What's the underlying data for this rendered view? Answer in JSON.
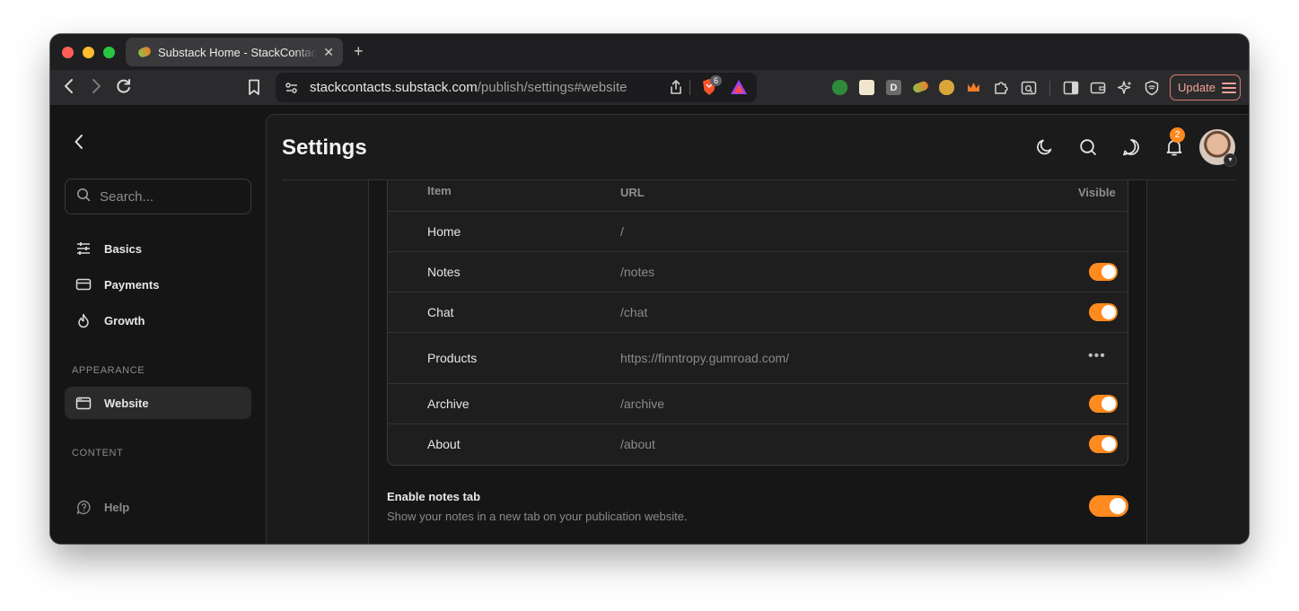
{
  "browser": {
    "tab_title": "Substack Home - StackContacts",
    "url_host": "stackcontacts.substack.com",
    "url_path": "/publish/settings#website",
    "brave_badge": "6",
    "extensions": [
      "ext-green-icon",
      "ext-crown-badge-icon",
      "ext-d-icon",
      "ext-leaf-icon",
      "ext-monkey-icon",
      "ext-crown-icon",
      "puzzle-icon",
      "ext-search-icon"
    ],
    "update_label": "Update"
  },
  "sidebar": {
    "search_placeholder": "Search...",
    "items": [
      {
        "label": "Basics",
        "icon": "sliders-icon"
      },
      {
        "label": "Payments",
        "icon": "card-icon"
      },
      {
        "label": "Growth",
        "icon": "flame-icon"
      }
    ],
    "sections": {
      "appearance": "APPEARANCE",
      "content": "CONTENT"
    },
    "website_label": "Website",
    "help_label": "Help"
  },
  "header": {
    "title": "Settings",
    "notification_count": "2"
  },
  "nav_table": {
    "headers": {
      "item": "Item",
      "url": "URL",
      "visible": "Visible"
    },
    "rows": [
      {
        "item": "Home",
        "url": "/",
        "control": "none"
      },
      {
        "item": "Notes",
        "url": "/notes",
        "control": "toggle",
        "on": true
      },
      {
        "item": "Chat",
        "url": "/chat",
        "control": "toggle",
        "on": true
      },
      {
        "item": "Products",
        "url": "https://finntropy.gumroad.com/",
        "control": "more"
      },
      {
        "item": "Archive",
        "url": "/archive",
        "control": "toggle",
        "on": true
      },
      {
        "item": "About",
        "url": "/about",
        "control": "toggle",
        "on": true
      }
    ]
  },
  "notes_setting": {
    "title": "Enable notes tab",
    "description": "Show your notes in a new tab on your publication website.",
    "enabled": true
  },
  "colors": {
    "accent": "#ff8a1f",
    "background": "#151515"
  }
}
